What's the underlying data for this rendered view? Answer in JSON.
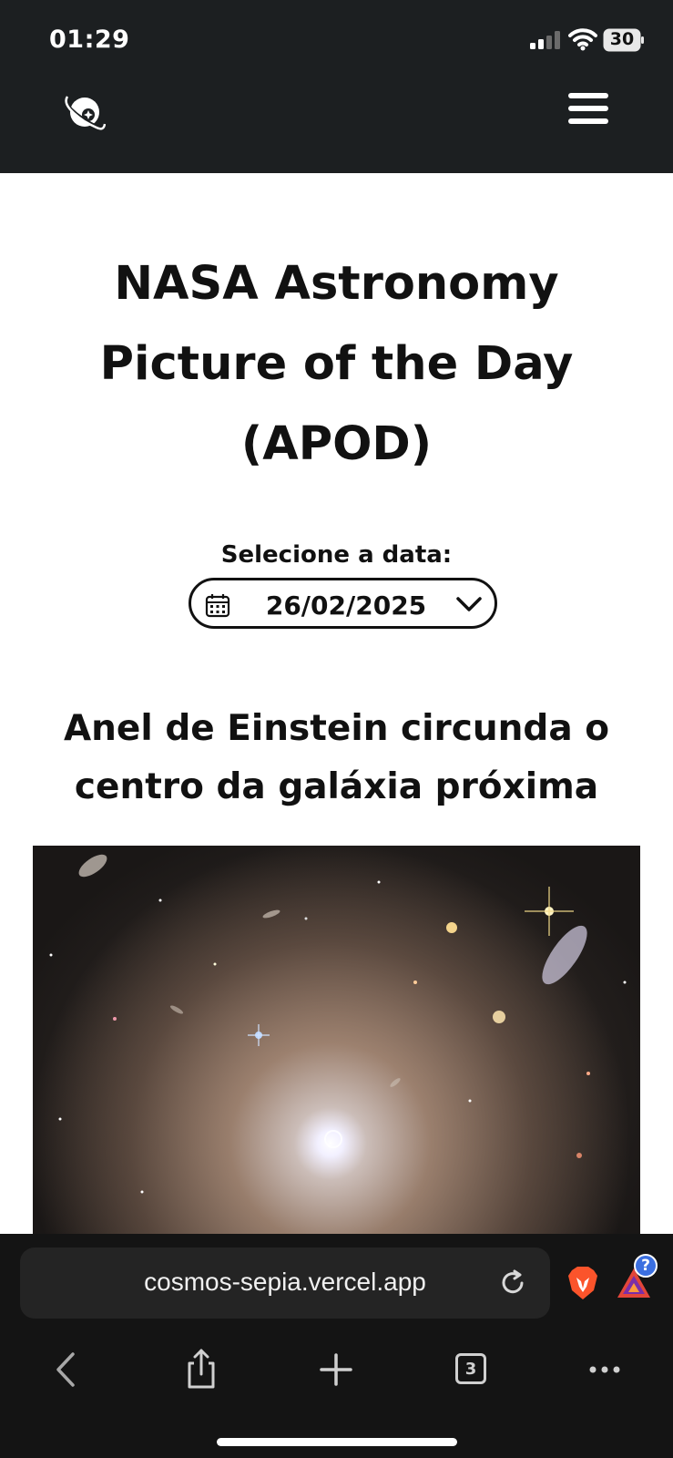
{
  "status_bar": {
    "time": "01:29",
    "battery": "30"
  },
  "header": {
    "logo_icon": "planet-logo-icon",
    "menu_icon": "hamburger-menu-icon"
  },
  "main": {
    "title": "NASA Astronomy Picture of the Day (APOD)",
    "date_label": "Selecione a data:",
    "date_value": "26/02/2025",
    "apod_title": "Anel de Einstein circunda o centro da galáxia próxima"
  },
  "browser": {
    "url": "cosmos-sepia.vercel.app",
    "tab_count": "3",
    "notification_badge": "?",
    "colors": {
      "brave": "#fb542b",
      "badge": "#3b6fe0"
    }
  }
}
